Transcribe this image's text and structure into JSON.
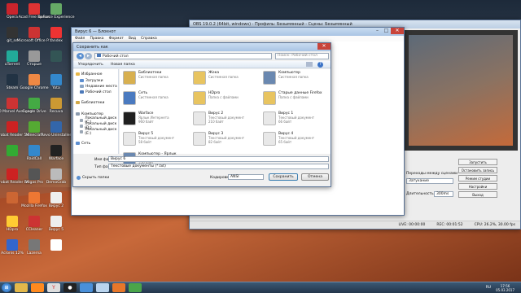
{
  "desktop_icons": [
    {
      "label": "Opera",
      "color": "#c9242c"
    },
    {
      "label": "Acad Free Ярлык",
      "color": "#d33"
    },
    {
      "label": "GeForce Experience",
      "color": "#6a6"
    },
    {
      "label": "git_se",
      "color": "#333"
    },
    {
      "label": "Microsoft Office P...",
      "color": "#c33"
    },
    {
      "label": "Yandex",
      "color": "#e33"
    },
    {
      "label": "uTorrent",
      "color": "#2a9"
    },
    {
      "label": "Старые",
      "color": "#999"
    },
    {
      "label": "",
      "color": "#355"
    },
    {
      "label": "Steam",
      "color": "#234"
    },
    {
      "label": "Google Chrome",
      "color": "#e84"
    },
    {
      "label": "Yota",
      "color": "#38c"
    },
    {
      "label": "LEGO Marvel Avengers",
      "color": "#c33"
    },
    {
      "label": "Google Drive",
      "color": "#4a4"
    },
    {
      "label": "Recuva",
      "color": "#c93"
    },
    {
      "label": "Acrobat Reader 5.0",
      "color": "#c22"
    },
    {
      "label": "Minecraft",
      "color": "#5a3"
    },
    {
      "label": "Revo Uninstaller",
      "color": "#36a"
    },
    {
      "label": "",
      "color": "#3a3"
    },
    {
      "label": "RaidCall",
      "color": "#38c"
    },
    {
      "label": "Warface",
      "color": "#222"
    },
    {
      "label": "Acrobat Reader DC",
      "color": "#c22"
    },
    {
      "label": "Vegas Pro",
      "color": "#555"
    },
    {
      "label": "DemoGrab",
      "color": "#bbb"
    },
    {
      "label": "",
      "color": "#c63"
    },
    {
      "label": "Mozilla Firefox",
      "color": "#e73"
    },
    {
      "label": "Вирус 2",
      "color": "#eee"
    },
    {
      "label": "HDpro",
      "color": "#fc3"
    },
    {
      "label": "CCleaner",
      "color": "#c33"
    },
    {
      "label": "Вирус 5",
      "color": "#eee"
    },
    {
      "label": "Acronis 12%",
      "color": "#36c"
    },
    {
      "label": "Lazerna",
      "color": "#777"
    },
    {
      "label": "",
      "color": "#fff"
    }
  ],
  "dialog": {
    "title": "Сохранить как",
    "address": "Рабочий стол",
    "search_placeholder": "Поиск: Рабочий стол",
    "toolbar": {
      "organize": "Упорядочить",
      "new_folder": "Новая папка"
    },
    "nav_items": [
      {
        "label": "Избранное",
        "color": "#e8b84a"
      },
      {
        "label": "Загрузки",
        "color": "#5c8ed0"
      },
      {
        "label": "Недавние места",
        "color": "#8aa4c4"
      },
      {
        "label": "Рабочий стол",
        "color": "#4a78b8"
      },
      {
        "label": "Библиотеки",
        "color": "#d0a848"
      },
      {
        "label": "Компьютер",
        "color": "#8a9aae"
      },
      {
        "label": "Локальный диск (C:)",
        "color": "#9aa6b4"
      },
      {
        "label": "Локальный диск (D:)",
        "color": "#9aa6b4"
      },
      {
        "label": "Локальный диск (E:)",
        "color": "#9aa6b4"
      },
      {
        "label": "Сеть",
        "color": "#5c8ed0"
      }
    ],
    "files": [
      {
        "name": "Библиотеки",
        "type": "Системная папка",
        "size": "",
        "color": "#d8b050"
      },
      {
        "name": "Жека",
        "type": "Системная папка",
        "size": "",
        "color": "#e8c460"
      },
      {
        "name": "Компьютер",
        "type": "Системная папка",
        "size": "",
        "color": "#6a88b0"
      },
      {
        "name": "Сеть",
        "type": "Системная папка",
        "size": "",
        "color": "#4a7ac0"
      },
      {
        "name": "HDpro",
        "type": "Папка с файлами",
        "size": "",
        "color": "#e8c460"
      },
      {
        "name": "Старые данные Firefox",
        "type": "Папка с файлами",
        "size": "",
        "color": "#e8c460"
      },
      {
        "name": "Warface",
        "type": "Ярлык Интернета",
        "size": "960 байт",
        "color": "#202020"
      },
      {
        "name": "Вирус 2",
        "type": "Текстовый документ",
        "size": "210 байт",
        "color": "#e8e8e8"
      },
      {
        "name": "Вирус 1",
        "type": "Текстовый документ",
        "size": "66 байт",
        "color": "#e8e8e8"
      },
      {
        "name": "Вирус 5",
        "type": "Текстовый документ",
        "size": "58 байт",
        "color": "#e8e8e8"
      },
      {
        "name": "Вирус 3",
        "type": "Текстовый документ",
        "size": "82 байт",
        "color": "#e8e8e8"
      },
      {
        "name": "Вирус 4",
        "type": "Текстовый документ",
        "size": "65 байт",
        "color": "#e8e8e8"
      },
      {
        "name": "Компьютер - Ярлык",
        "type": "Ярлык",
        "size": "556 байт",
        "color": "#6a88b0"
      }
    ],
    "filename_label": "Имя файла:",
    "filename_value": "Вирус 6",
    "filetype_label": "Тип файла:",
    "filetype_value": "Текстовые документы (*.txt)",
    "encoding_label": "Кодировка:",
    "encoding_value": "ANSI",
    "hide_folders": "Скрыть папки",
    "save": "Сохранить",
    "cancel": "Отмена"
  },
  "notepad": {
    "title": "Вирус 6 — Блокнот",
    "menu": [
      "Файл",
      "Правка",
      "Формат",
      "Вид",
      "Справка"
    ]
  },
  "obs": {
    "title": "OBS 19.0.2 (64bit, windows) - Профиль: Безымянный - Сцены: Безымянный",
    "transitions_header": "Переходы между сценами",
    "transition_value": "Затухание",
    "duration_label": "Длительность",
    "duration_value": "300ms",
    "buttons": [
      "Запустить трансляцию",
      "Остановить запись",
      "Режим студии",
      "Настройки",
      "Выход"
    ],
    "status": {
      "live": "LIVE: 00:00:00",
      "rec": "REC: 00:01:52",
      "cpu": "CPU: 26.2%, 30.00 fps"
    }
  },
  "clock": {
    "time": "17:56",
    "date": "05.03.2017"
  },
  "taskbar": {
    "lang": "RU"
  }
}
